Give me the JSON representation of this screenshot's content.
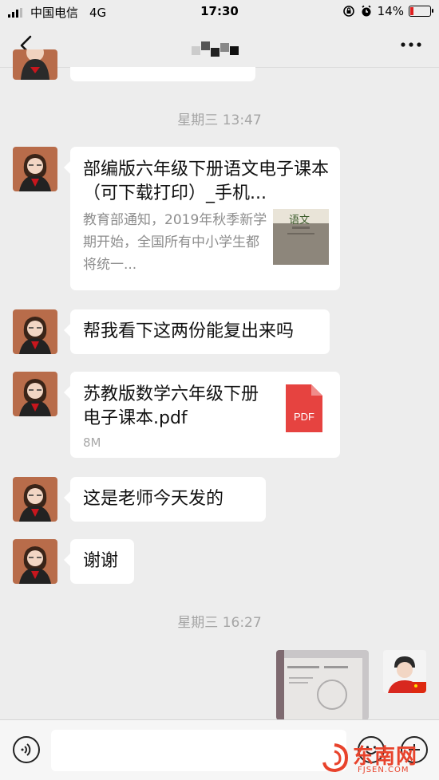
{
  "status_bar": {
    "carrier": "中国电信",
    "network": "4G",
    "time": "17:30",
    "battery": "14%"
  },
  "nav": {
    "title_masked": true
  },
  "messages": {
    "time_sep_1": "星期三 13:47",
    "link_card": {
      "title": "部编版六年级下册语文电子课本（可下载打印）_手机...",
      "description": "教育部通知，2019年秋季新学期开始，全国所有中小学生都将统一...",
      "thumb_text": "语文"
    },
    "text_1": "帮我看下这两份能复出来吗",
    "file_card": {
      "name": "苏教版数学六年级下册电子课本.pdf",
      "size": "8M",
      "icon_label": "PDF"
    },
    "text_2": "这是老师今天发的",
    "text_3": "谢谢",
    "time_sep_2": "星期三 16:27"
  },
  "watermark": {
    "brand": "东南网",
    "domain": "FJSEN.COM"
  },
  "colors": {
    "background": "#ededed",
    "bubble": "#ffffff",
    "pdf_red": "#e64340",
    "watermark_red": "#e8432c"
  }
}
